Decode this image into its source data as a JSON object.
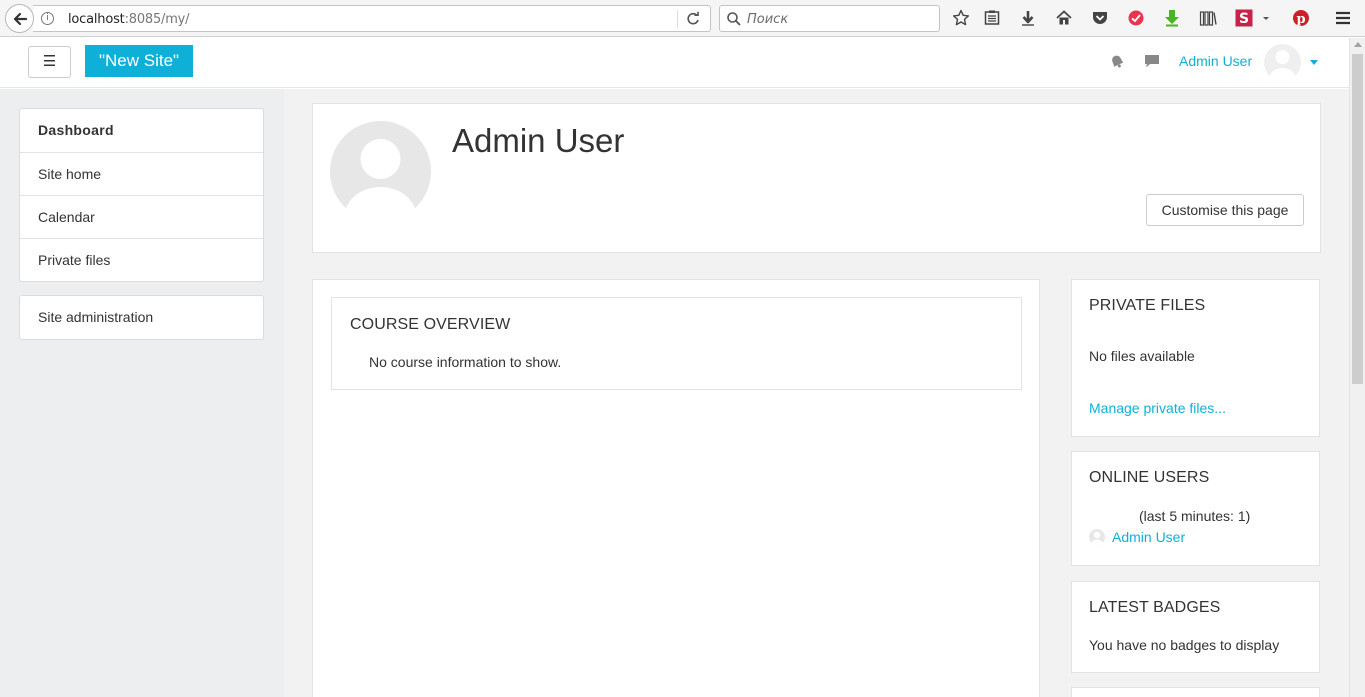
{
  "browser": {
    "url_host": "localhost",
    "url_rest": ":8085/my/",
    "search_placeholder": "Поиск"
  },
  "navbar": {
    "menu_toggle": "☰",
    "site_name": "\"New Site\"",
    "user_name": "Admin User"
  },
  "drawer": {
    "items": [
      "Dashboard",
      "Site home",
      "Calendar",
      "Private files"
    ],
    "admin": "Site administration"
  },
  "header": {
    "title": "Admin User",
    "customise_label": "Customise this page"
  },
  "course_overview": {
    "title": "COURSE OVERVIEW",
    "empty": "No course information to show."
  },
  "private_files": {
    "title": "PRIVATE FILES",
    "empty": "No files available",
    "manage_link": "Manage private files..."
  },
  "online_users": {
    "title": "ONLINE USERS",
    "window": "(last 5 minutes: 1)",
    "user": "Admin User"
  },
  "latest_badges": {
    "title": "LATEST BADGES",
    "empty": "You have no badges to display"
  },
  "colors": {
    "brand": "#0fb0d8",
    "drawer_bg": "#eceef0",
    "content_bg": "#f2f2f2"
  }
}
